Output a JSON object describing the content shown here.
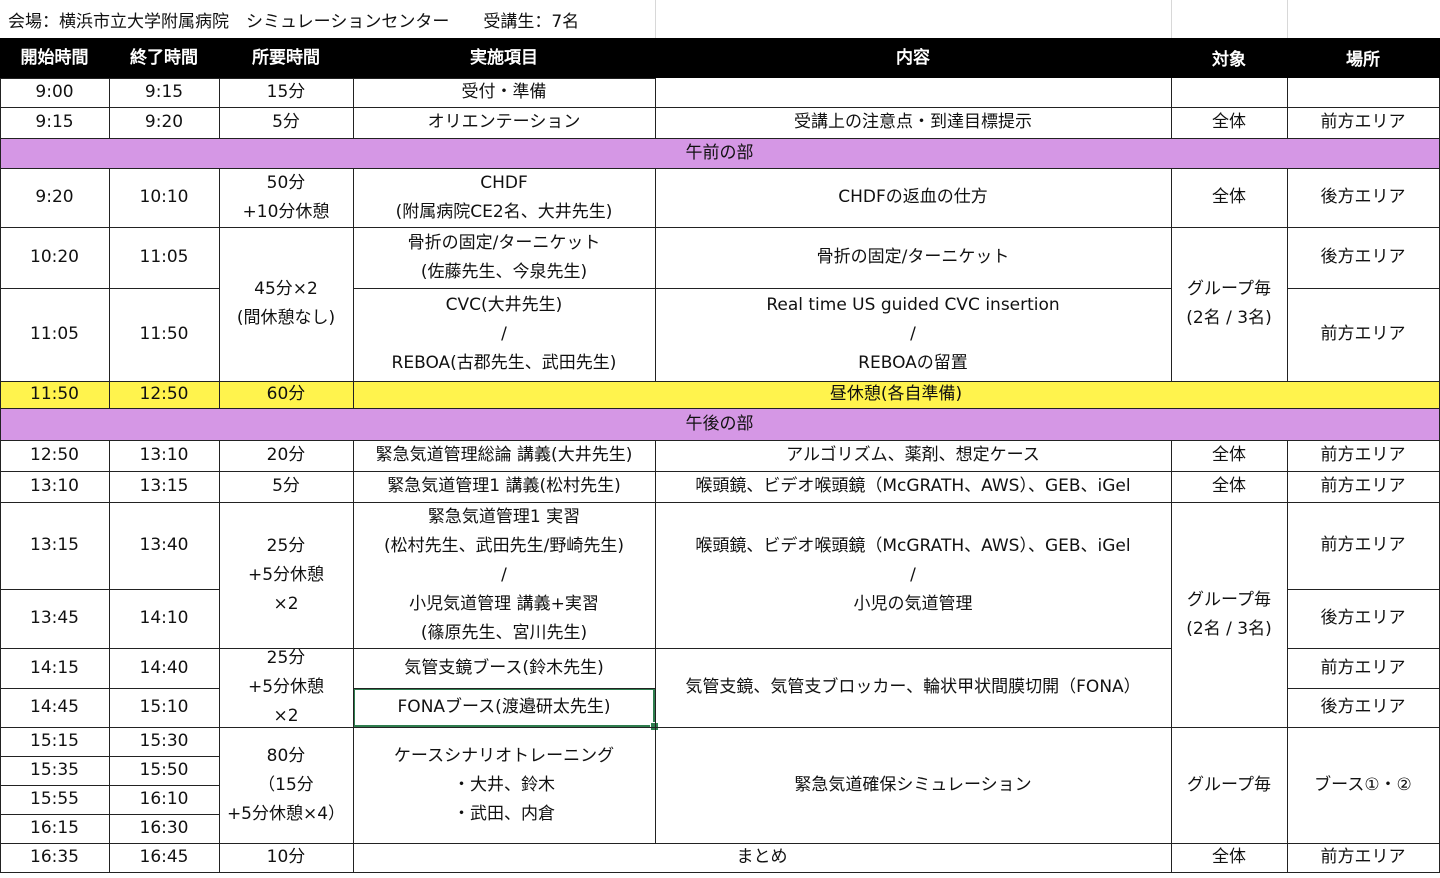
{
  "info": "会場：横浜市立大学附属病院　シミュレーションセンター　　受講生：7名",
  "columns": [
    "開始時間",
    "終了時間",
    "所要時間",
    "実施項目",
    "内容",
    "対象",
    "場所"
  ],
  "cells": [
    {
      "c": 0,
      "r": 0,
      "t": "9:00"
    },
    {
      "c": 1,
      "r": 0,
      "t": "9:15"
    },
    {
      "c": 2,
      "r": 0,
      "t": "15分"
    },
    {
      "c": 3,
      "r": 0,
      "t": "受付・準備"
    },
    {
      "c": 0,
      "r": 1,
      "t": "9:15"
    },
    {
      "c": 1,
      "r": 1,
      "t": "9:20"
    },
    {
      "c": 2,
      "r": 1,
      "t": "5分"
    },
    {
      "c": 3,
      "r": 1,
      "t": "オリエンテーション"
    },
    {
      "c": 4,
      "r": 1,
      "t": "受講上の注意点・到達目標提示"
    },
    {
      "c": 5,
      "r": 1,
      "t": "全体"
    },
    {
      "c": 6,
      "r": 1,
      "t": "前方エリア"
    },
    {
      "c": 0,
      "c2": 6,
      "r": 2,
      "t": "午前の部",
      "cls": "purple"
    },
    {
      "c": 0,
      "r": 3,
      "t": "9:20"
    },
    {
      "c": 1,
      "r": 3,
      "t": "10:10"
    },
    {
      "c": 2,
      "r": 3,
      "t": "50分\n+10分休憩"
    },
    {
      "c": 3,
      "r": 3,
      "t": "CHDF\n(附属病院CE2名、大井先生)"
    },
    {
      "c": 4,
      "r": 3,
      "t": "CHDFの返血の仕方"
    },
    {
      "c": 5,
      "r": 3,
      "t": "全体"
    },
    {
      "c": 6,
      "r": 3,
      "t": "後方エリア"
    },
    {
      "c": 0,
      "r": 4,
      "t": "10:20"
    },
    {
      "c": 1,
      "r": 4,
      "t": "11:05"
    },
    {
      "c": 2,
      "r": 4,
      "r2": 5,
      "t": "45分×2\n(間休憩なし)"
    },
    {
      "c": 3,
      "r": 4,
      "t": "骨折の固定/ターニケット\n(佐藤先生、今泉先生)"
    },
    {
      "c": 4,
      "r": 4,
      "t": "骨折の固定/ターニケット"
    },
    {
      "c": 5,
      "r": 4,
      "r2": 5,
      "t": "グループ毎\n(2名 / 3名)"
    },
    {
      "c": 6,
      "r": 4,
      "t": "後方エリア"
    },
    {
      "c": 0,
      "r": 5,
      "t": "11:05"
    },
    {
      "c": 1,
      "r": 5,
      "t": "11:50"
    },
    {
      "c": 3,
      "r": 5,
      "t": "CVC(大井先生)\n/\nREBOA(古郡先生、武田先生)"
    },
    {
      "c": 4,
      "r": 5,
      "t": "Real time US guided CVC insertion\n/\nREBOAの留置"
    },
    {
      "c": 6,
      "r": 5,
      "t": "前方エリア"
    },
    {
      "c": 0,
      "r": 6,
      "t": "11:50",
      "cls": "yellow"
    },
    {
      "c": 1,
      "r": 6,
      "t": "12:50",
      "cls": "yellow"
    },
    {
      "c": 2,
      "r": 6,
      "t": "60分",
      "cls": "yellow"
    },
    {
      "c": 3,
      "c2": 6,
      "r": 6,
      "t": "昼休憩(各自準備)",
      "cls": "yellow"
    },
    {
      "c": 0,
      "c2": 6,
      "r": 7,
      "t": "午後の部",
      "cls": "purple"
    },
    {
      "c": 0,
      "r": 8,
      "t": "12:50"
    },
    {
      "c": 1,
      "r": 8,
      "t": "13:10"
    },
    {
      "c": 2,
      "r": 8,
      "t": "20分"
    },
    {
      "c": 3,
      "r": 8,
      "t": "緊急気道管理総論 講義(大井先生)"
    },
    {
      "c": 4,
      "r": 8,
      "t": "アルゴリズム、薬剤、想定ケース"
    },
    {
      "c": 5,
      "r": 8,
      "t": "全体"
    },
    {
      "c": 6,
      "r": 8,
      "t": "前方エリア"
    },
    {
      "c": 0,
      "r": 9,
      "t": "13:10"
    },
    {
      "c": 1,
      "r": 9,
      "t": "13:15"
    },
    {
      "c": 2,
      "r": 9,
      "t": "5分"
    },
    {
      "c": 3,
      "r": 9,
      "t": "緊急気道管理1 講義(松村先生)"
    },
    {
      "c": 4,
      "r": 9,
      "t": "喉頭鏡、ビデオ喉頭鏡（McGRATH、AWS）、GEB、iGel"
    },
    {
      "c": 5,
      "r": 9,
      "t": "全体"
    },
    {
      "c": 6,
      "r": 9,
      "t": "前方エリア"
    },
    {
      "c": 0,
      "r": 10,
      "t": "13:15"
    },
    {
      "c": 1,
      "r": 10,
      "t": "13:40"
    },
    {
      "c": 2,
      "r": 10,
      "r2": 11,
      "t": "25分\n+5分休憩\n×2"
    },
    {
      "c": 3,
      "r": 10,
      "r2": 11,
      "t": "緊急気道管理1 実習\n(松村先生、武田先生/野崎先生)\n/\n小児気道管理 講義+実習\n(篠原先生、宮川先生)"
    },
    {
      "c": 4,
      "r": 10,
      "r2": 11,
      "t": "喉頭鏡、ビデオ喉頭鏡（McGRATH、AWS）、GEB、iGel\n/\n小児の気道管理"
    },
    {
      "c": 5,
      "r": 10,
      "r2": 13,
      "t": "グループ毎\n(2名 / 3名)"
    },
    {
      "c": 6,
      "r": 10,
      "t": "前方エリア"
    },
    {
      "c": 0,
      "r": 11,
      "t": "13:45"
    },
    {
      "c": 1,
      "r": 11,
      "t": "14:10"
    },
    {
      "c": 6,
      "r": 11,
      "t": "後方エリア"
    },
    {
      "c": 0,
      "r": 12,
      "t": "14:15"
    },
    {
      "c": 1,
      "r": 12,
      "t": "14:40"
    },
    {
      "c": 2,
      "r": 12,
      "r2": 13,
      "t": "25分\n+5分休憩\n×2"
    },
    {
      "c": 3,
      "r": 12,
      "t": "気管支鏡ブース(鈴木先生)"
    },
    {
      "c": 4,
      "r": 12,
      "r2": 13,
      "t": "気管支鏡、気管支ブロッカー、輪状甲状間膜切開（FONA）"
    },
    {
      "c": 6,
      "r": 12,
      "t": "前方エリア"
    },
    {
      "c": 0,
      "r": 13,
      "t": "14:45"
    },
    {
      "c": 1,
      "r": 13,
      "t": "15:10"
    },
    {
      "c": 3,
      "r": 13,
      "t": "FONAブース(渡邉研太先生)",
      "cls": "selected"
    },
    {
      "c": 6,
      "r": 13,
      "t": "後方エリア"
    },
    {
      "c": 0,
      "r": 14,
      "t": "15:15"
    },
    {
      "c": 1,
      "r": 14,
      "t": "15:30"
    },
    {
      "c": 2,
      "r": 14,
      "r2": 17,
      "t": "80分\n（15分\n+5分休憩×4）"
    },
    {
      "c": 3,
      "r": 14,
      "r2": 17,
      "t": "ケースシナリオトレーニング\n・大井、鈴木\n・武田、内倉"
    },
    {
      "c": 4,
      "r": 14,
      "r2": 17,
      "t": "緊急気道確保シミュレーション"
    },
    {
      "c": 5,
      "r": 14,
      "r2": 17,
      "t": "グループ毎"
    },
    {
      "c": 6,
      "r": 14,
      "r2": 17,
      "t": "ブース①・②"
    },
    {
      "c": 0,
      "r": 15,
      "t": "15:35"
    },
    {
      "c": 1,
      "r": 15,
      "t": "15:50"
    },
    {
      "c": 0,
      "r": 16,
      "t": "15:55"
    },
    {
      "c": 1,
      "r": 16,
      "t": "16:10"
    },
    {
      "c": 0,
      "r": 17,
      "t": "16:15"
    },
    {
      "c": 1,
      "r": 17,
      "t": "16:30"
    },
    {
      "c": 0,
      "r": 18,
      "t": "16:35"
    },
    {
      "c": 1,
      "r": 18,
      "t": "16:45"
    },
    {
      "c": 2,
      "r": 18,
      "t": "10分"
    },
    {
      "c": 3,
      "c2": 4,
      "r": 18,
      "t": "まとめ"
    },
    {
      "c": 5,
      "r": 18,
      "t": "全体"
    },
    {
      "c": 6,
      "r": 18,
      "t": "前方エリア"
    }
  ]
}
